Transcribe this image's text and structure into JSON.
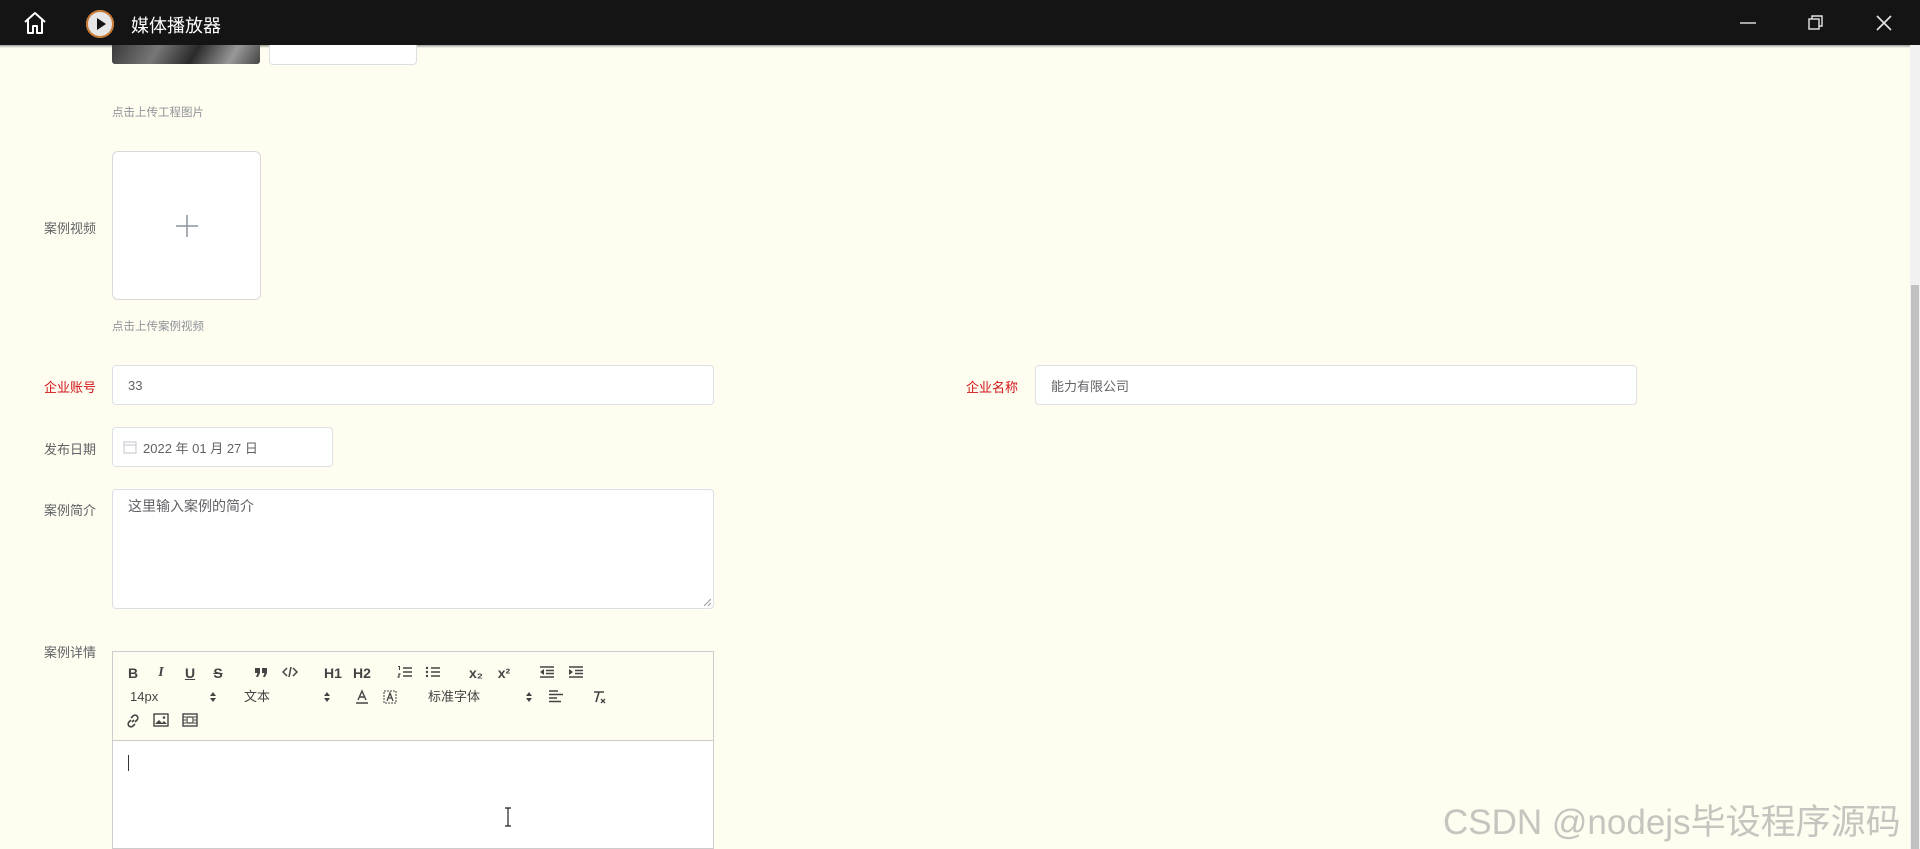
{
  "window": {
    "title": "媒体播放器",
    "icons": {
      "home": "home-icon",
      "app": "play-circle-icon",
      "minimize": "minimize-icon",
      "maximize": "restore-icon",
      "close": "close-icon"
    }
  },
  "form": {
    "engineering_image_hint": "点击上传工程图片",
    "case_video": {
      "label": "案例视频",
      "hint": "点击上传案例视频",
      "icon": "plus-icon"
    },
    "company_account": {
      "label": "企业账号",
      "value": "33"
    },
    "company_name": {
      "label": "企业名称",
      "value": "能力有限公司"
    },
    "publish_date": {
      "label": "发布日期",
      "value": "2022 年 01 月 27 日",
      "icon": "calendar-icon"
    },
    "case_summary": {
      "label": "案例简介",
      "value": "这里输入案例的简介"
    },
    "case_details": {
      "label": "案例详情",
      "toolbar": {
        "bold": "B",
        "italic": "I",
        "underline": "U",
        "strike": "S",
        "h1": "H1",
        "h2": "H2",
        "subscript": "x₂",
        "superscript": "x²",
        "size": "14px",
        "header": "文本",
        "font": "标准字体"
      }
    }
  },
  "watermark": "CSDN @nodejs毕设程序源码",
  "colors": {
    "required_label": "#d1131a",
    "background": "#fffdf0",
    "titlebar": "#141414"
  }
}
